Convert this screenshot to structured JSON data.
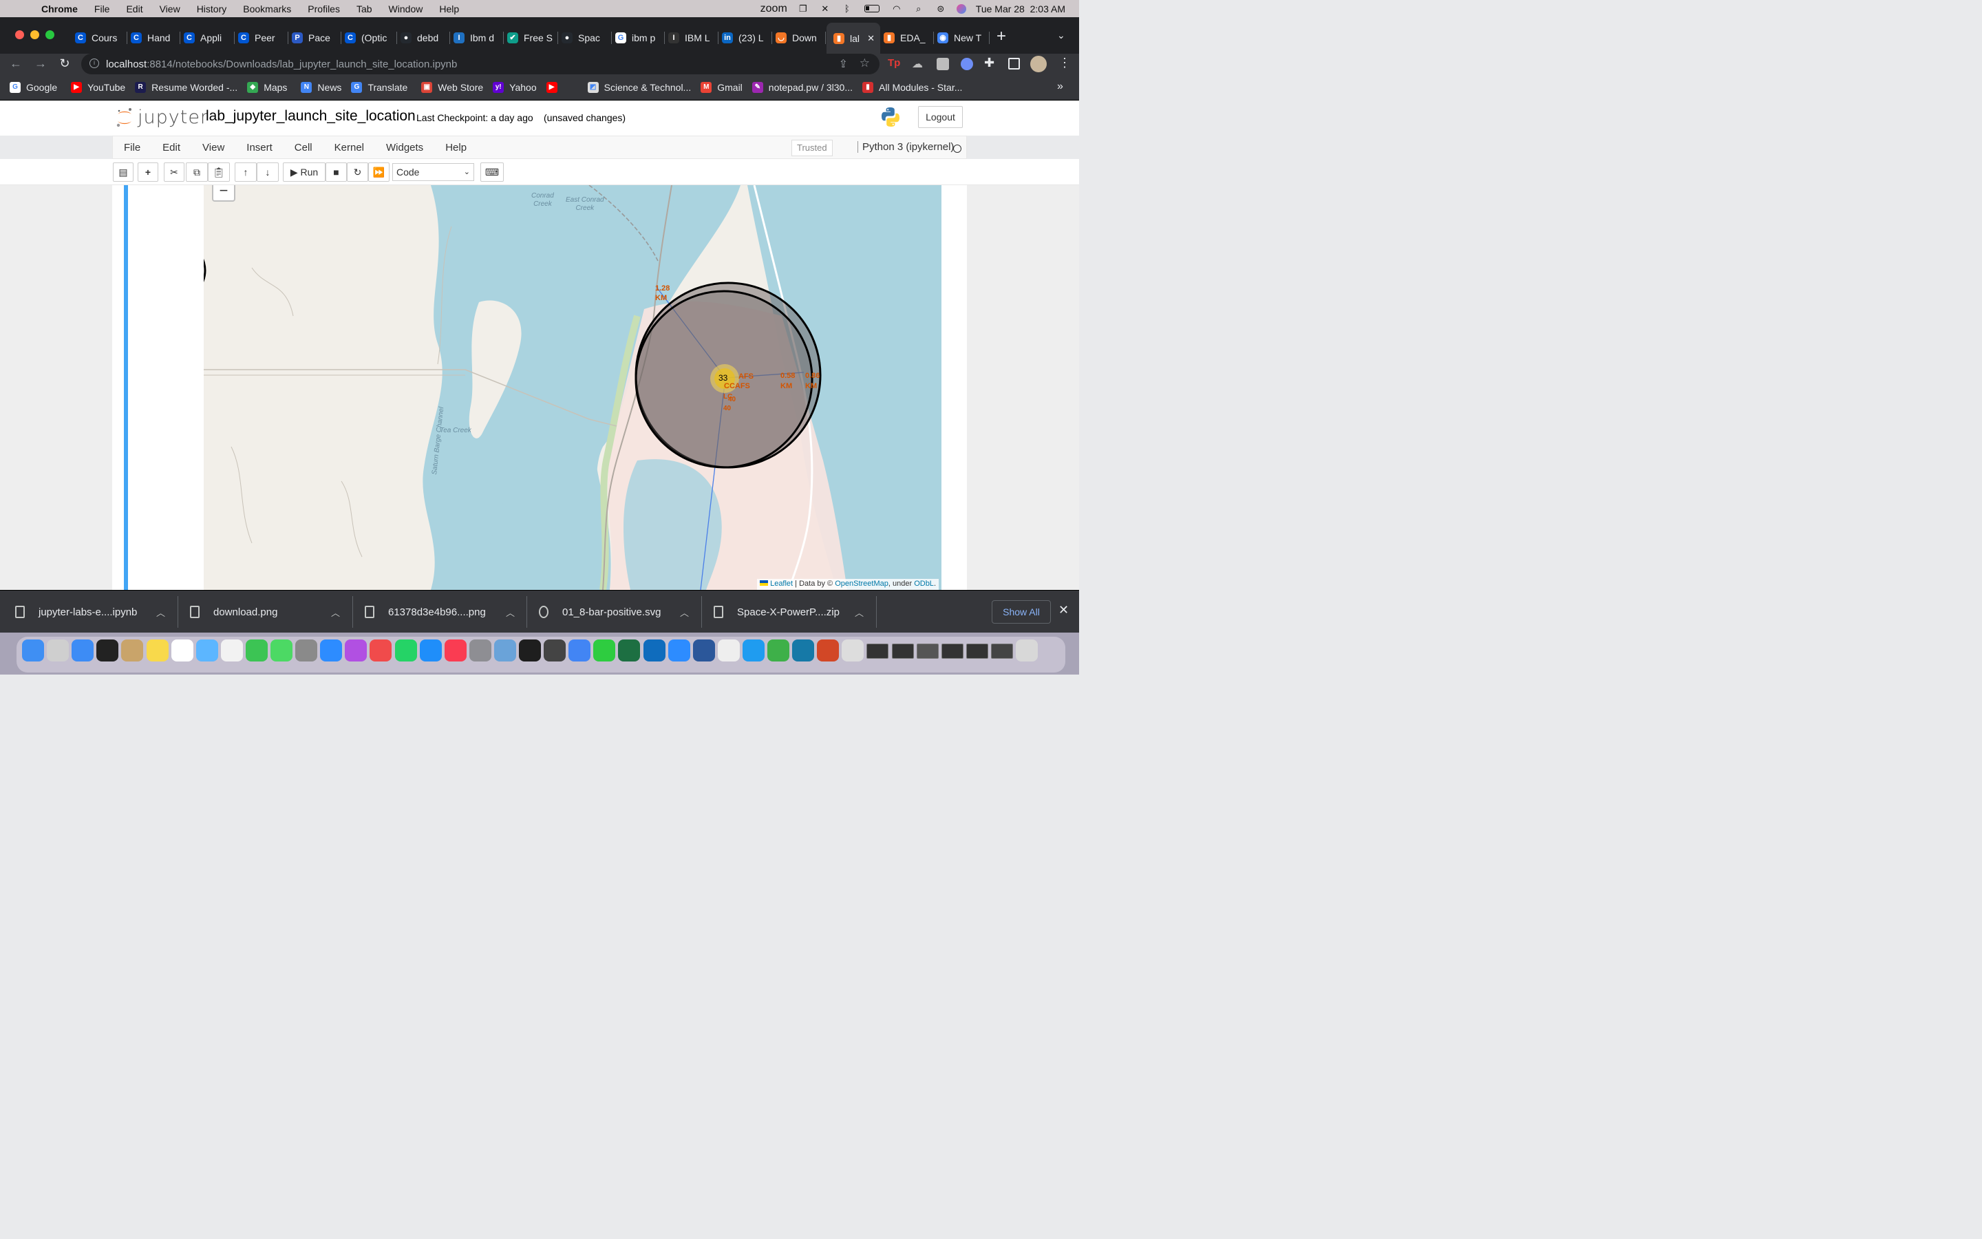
{
  "menubar": {
    "app": "Chrome",
    "items": [
      "File",
      "Edit",
      "View",
      "History",
      "Bookmarks",
      "Profiles",
      "Tab",
      "Window",
      "Help"
    ],
    "zoom": "zoom",
    "clock": "Tue Mar 28  2:03 AM"
  },
  "tabs": [
    {
      "label": "Cours",
      "icon": "coursera-icon",
      "color": "#0056d2",
      "glyph": "C"
    },
    {
      "label": "Hand",
      "icon": "coursera-icon",
      "color": "#0056d2",
      "glyph": "C"
    },
    {
      "label": "Appli",
      "icon": "coursera-icon",
      "color": "#0056d2",
      "glyph": "C"
    },
    {
      "label": "Peer",
      "icon": "coursera-icon",
      "color": "#0056d2",
      "glyph": "C"
    },
    {
      "label": "Pace",
      "icon": "pace-icon",
      "color": "#2b59c3",
      "glyph": "P"
    },
    {
      "label": "(Optic",
      "icon": "coursera-icon",
      "color": "#0056d2",
      "glyph": "C"
    },
    {
      "label": "debd",
      "icon": "github-icon",
      "color": "#24292f",
      "glyph": "●"
    },
    {
      "label": "Ibm d",
      "icon": "ibm-icon",
      "color": "#1f70c1",
      "glyph": "I"
    },
    {
      "label": "Free S",
      "icon": "free-icon",
      "color": "#0f9d8a",
      "glyph": "✔"
    },
    {
      "label": "Spac",
      "icon": "github-icon",
      "color": "#24292f",
      "glyph": "●"
    },
    {
      "label": "ibm p",
      "icon": "google-icon",
      "color": "#ffffff",
      "glyph": "G"
    },
    {
      "label": "IBM L",
      "icon": "ibm-icon",
      "color": "#333333",
      "glyph": "I"
    },
    {
      "label": "(23) L",
      "icon": "linkedin-icon",
      "color": "#0a66c2",
      "glyph": "in"
    },
    {
      "label": "Down",
      "icon": "jupyter-icon",
      "color": "#f37626",
      "glyph": "◡"
    },
    {
      "label": "lal",
      "icon": "jupyter-notebook-icon",
      "color": "#f37626",
      "glyph": "▮",
      "active": true
    },
    {
      "label": "EDA_",
      "icon": "jupyter-notebook-icon",
      "color": "#f37626",
      "glyph": "▮"
    },
    {
      "label": "New T",
      "icon": "chrome-icon",
      "color": "#4285f4",
      "glyph": "◉"
    }
  ],
  "omnibox": {
    "host": "localhost",
    "path": ":8814/notebooks/Downloads/lab_jupyter_launch_site_location.ipynb"
  },
  "bookmarks": [
    {
      "label": "Google",
      "icon": "google-icon",
      "color": "#ffffff",
      "glyph": "G"
    },
    {
      "label": "YouTube",
      "icon": "youtube-icon",
      "color": "#ff0000",
      "glyph": "▶"
    },
    {
      "label": "Resume Worded -...",
      "icon": "resume-worded-icon",
      "color": "#1c1c4e",
      "glyph": "R"
    },
    {
      "label": "Maps",
      "icon": "maps-icon",
      "color": "#34a853",
      "glyph": "◆"
    },
    {
      "label": "News",
      "icon": "news-icon",
      "color": "#4285f4",
      "glyph": "N"
    },
    {
      "label": "Translate",
      "icon": "translate-icon",
      "color": "#4285f4",
      "glyph": "G"
    },
    {
      "label": "Web Store",
      "icon": "webstore-icon",
      "color": "#db4437",
      "glyph": "▣"
    },
    {
      "label": "Yahoo",
      "icon": "yahoo-icon",
      "color": "#6001d2",
      "glyph": "y!"
    },
    {
      "label": "",
      "icon": "youtube-icon",
      "color": "#ff0000",
      "glyph": "▶"
    },
    {
      "label": "Science & Technol...",
      "icon": "science-icon",
      "color": "#dddddd",
      "glyph": "◩"
    },
    {
      "label": "Gmail",
      "icon": "gmail-icon",
      "color": "#ea4335",
      "glyph": "M"
    },
    {
      "label": "notepad.pw / 3l30...",
      "icon": "notepad-icon",
      "color": "#9c27b0",
      "glyph": "✎"
    },
    {
      "label": "All Modules - Star...",
      "icon": "modules-icon",
      "color": "#d32f2f",
      "glyph": "▮"
    }
  ],
  "jupyter": {
    "logo": "jupyter",
    "notebook_title": "lab_jupyter_launch_site_location",
    "checkpoint": "Last Checkpoint: a day ago",
    "unsaved": "(unsaved changes)",
    "logout": "Logout",
    "menu": [
      "File",
      "Edit",
      "View",
      "Insert",
      "Cell",
      "Kernel",
      "Widgets",
      "Help"
    ],
    "trusted": "Trusted",
    "kernel": "Python 3 (ipykernel)",
    "run_label": "Run",
    "cell_type": "Code"
  },
  "map": {
    "labels": {
      "conrad_creek": [
        "Conrad",
        "Creek"
      ],
      "east_conrad_creek": [
        "East Conrad",
        "Creek"
      ],
      "tea_creek": "Tea Creek",
      "saturn_barge": "Saturn Barge Channel"
    },
    "cluster_count": "33",
    "site_label_1": "AFS",
    "site_label_2": "CCAFS",
    "site_label_3": "LC",
    "site_label_4": "40",
    "site_label_5": "40",
    "distances": [
      {
        "value": "1.28",
        "unit": "KM"
      },
      {
        "value": "0.58",
        "unit": "KM"
      },
      {
        "value": "0.86",
        "unit": "KM"
      }
    ],
    "zoom_out": "−",
    "attribution": {
      "leaflet": "Leaflet",
      "data_by": " | Data by © ",
      "osm": "OpenStreetMap",
      "under": ", under ",
      "odbl": "ODbL",
      "end": "."
    }
  },
  "downloads": [
    {
      "name": "jupyter-labs-e....ipynb"
    },
    {
      "name": "download.png"
    },
    {
      "name": "61378d3e4b96....png"
    },
    {
      "name": "01_8-bar-positive.svg"
    },
    {
      "name": "Space-X-PowerP....zip"
    }
  ],
  "show_all": "Show All",
  "dock": [
    {
      "icon": "finder-icon",
      "color": "#3f8ff3"
    },
    {
      "icon": "launchpad-icon",
      "color": "#cfcfcf"
    },
    {
      "icon": "mail-icon",
      "color": "#3d8cf5"
    },
    {
      "icon": "mission-control-icon",
      "color": "#222222"
    },
    {
      "icon": "contacts-icon",
      "color": "#c9a46a"
    },
    {
      "icon": "notes-icon",
      "color": "#f8d94b"
    },
    {
      "icon": "calendar-icon",
      "color": "#ffffff"
    },
    {
      "icon": "maps-app-icon",
      "color": "#5cb6ff"
    },
    {
      "icon": "photos-icon",
      "color": "#f2f2f2"
    },
    {
      "icon": "facetime-icon",
      "color": "#3cc454"
    },
    {
      "icon": "messages-icon",
      "color": "#4cd964"
    },
    {
      "icon": "spotlight-icon",
      "color": "#8a8a8a"
    },
    {
      "icon": "safari-icon",
      "color": "#2d8cff"
    },
    {
      "icon": "podcasts-icon",
      "color": "#b150e2"
    },
    {
      "icon": "news-app-icon",
      "color": "#f04b4b"
    },
    {
      "icon": "whatsapp-icon",
      "color": "#25d366"
    },
    {
      "icon": "app-store-icon",
      "color": "#1f8efa"
    },
    {
      "icon": "music-icon",
      "color": "#fa3c52"
    },
    {
      "icon": "settings-icon",
      "color": "#8e8e93"
    },
    {
      "icon": "preview-icon",
      "color": "#6aa3d9"
    },
    {
      "icon": "terminal-icon",
      "color": "#1e1e1e"
    },
    {
      "icon": "calculator-icon",
      "color": "#444444"
    },
    {
      "icon": "chrome-app-icon",
      "color": "#4285f4"
    },
    {
      "icon": "numbers-icon",
      "color": "#2ecc40"
    },
    {
      "icon": "excel-icon",
      "color": "#1d6f42"
    },
    {
      "icon": "outlook-icon",
      "color": "#0f6cbd"
    },
    {
      "icon": "zoom-app-icon",
      "color": "#2d8cff"
    },
    {
      "icon": "word-icon",
      "color": "#2b579a"
    },
    {
      "icon": "textedit-icon",
      "color": "#eeeeee"
    },
    {
      "icon": "vscode-icon",
      "color": "#1f9cf0"
    },
    {
      "icon": "anaconda-icon",
      "color": "#3eb049"
    },
    {
      "icon": "wireshark-icon",
      "color": "#1679a7"
    },
    {
      "icon": "powerpoint-icon",
      "color": "#d24726"
    },
    {
      "icon": "documents-icon",
      "color": "#dddddd"
    },
    {
      "icon": "window-thumb-icon",
      "color": "#333333"
    },
    {
      "icon": "window-thumb-icon",
      "color": "#333333"
    },
    {
      "icon": "window-thumb-icon",
      "color": "#555555"
    },
    {
      "icon": "window-thumb-icon",
      "color": "#333333"
    },
    {
      "icon": "window-thumb-icon",
      "color": "#333333"
    },
    {
      "icon": "window-thumb-icon",
      "color": "#444444"
    },
    {
      "icon": "trash-icon",
      "color": "#d8d8d8"
    }
  ]
}
